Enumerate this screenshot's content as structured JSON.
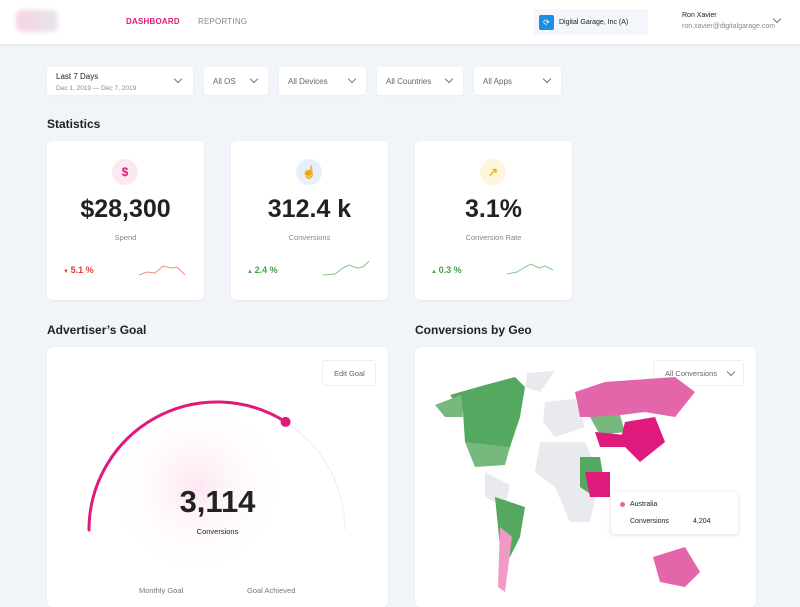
{
  "header": {
    "nav": [
      {
        "label": "DASHBOARD",
        "active": true
      },
      {
        "label": "REPORTING",
        "active": false
      }
    ],
    "org": "Digital Garage, Inc (A)",
    "user_name": "Ron Xavier",
    "user_email": "ron.xavier@digitalgarage.com"
  },
  "filters": {
    "date_label": "Last 7 Days",
    "date_range": "Dec 1, 2019 — Dec 7, 2019",
    "os": "All OS",
    "devices": "All Devices",
    "countries": "All Countries",
    "apps": "All Apps"
  },
  "statistics": {
    "title": "Statistics",
    "cards": [
      {
        "icon": "dollar-icon",
        "glyph": "$",
        "value": "$28,300",
        "label": "Spend",
        "change": "5.1 %",
        "direction": "down",
        "color": "#e53935"
      },
      {
        "icon": "pointer-hand-icon",
        "glyph": "☝",
        "value": "312.4 k",
        "label": "Conversions",
        "change": "2.4 %",
        "direction": "up",
        "color": "#43a047"
      },
      {
        "icon": "trending-up-icon",
        "glyph": "↗",
        "value": "3.1%",
        "label": "Conversion Rate",
        "change": "0.3 %",
        "direction": "up",
        "color": "#43a047"
      }
    ]
  },
  "goal": {
    "title": "Advertiser’s Goal",
    "edit_label": "Edit Goal",
    "value": "3,114",
    "label": "Conversions",
    "progress": 0.68,
    "monthly_label": "Monthly Goal",
    "achieved_label": "Goal Achieved"
  },
  "geo": {
    "title": "Conversions by Geo",
    "dropdown": "All Conversions",
    "tooltip": {
      "country": "Australia",
      "metric": "Conversions",
      "value": "4,204"
    }
  },
  "colors": {
    "accent": "#e0197d",
    "green": "#43a047",
    "red": "#e53935"
  }
}
